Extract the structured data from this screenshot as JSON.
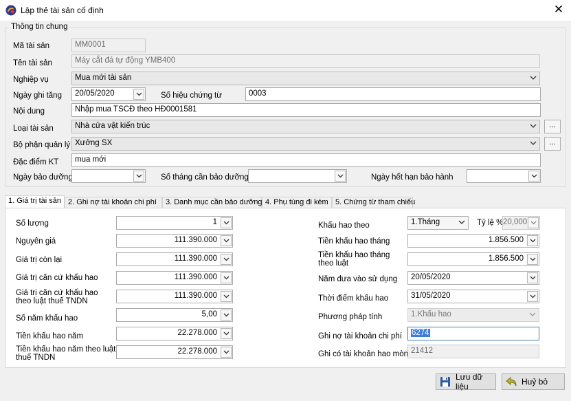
{
  "window": {
    "title": "Lập thẻ tài sản cố định"
  },
  "general": {
    "group_title": "Thông tin chung",
    "asset_code_label": "Mã tài sản",
    "asset_code": "MM0001",
    "asset_name_label": "Tên tài sản",
    "asset_name": "Máy cắt đá tự động YMB400",
    "operation_label": "Nghiệp vụ",
    "operation": "Mua mới tài sản",
    "date_label": "Ngày ghi tăng",
    "date": "20/05/2020",
    "voucher_label": "Số hiệu chứng từ",
    "voucher": "0003",
    "content_label": "Nội dung",
    "content": "Nhập mua TSCĐ theo HĐ0001581",
    "type_label": "Loại tài sản",
    "type": "Nhà cửa vật kiến trúc",
    "dept_label": "Bộ phận quản lý",
    "dept": "Xưởng SX",
    "feature_label": "Đặc điểm KT",
    "feature": "mua mới",
    "maint_date_label": "Ngày bảo dưỡng",
    "maint_date": "",
    "maint_months_label": "Số tháng cần bảo dưỡng",
    "maint_months": "",
    "warranty_label": "Ngày hết hạn bảo hành",
    "warranty": "",
    "ellipsis": "..."
  },
  "tabs": [
    {
      "label": "1. Giá trị tài sản"
    },
    {
      "label": "2. Ghi nợ tài khoản chi phí"
    },
    {
      "label": "3. Danh mục cần bảo dưỡng"
    },
    {
      "label": "4. Phụ tùng đi kèm"
    },
    {
      "label": "5. Chứng từ tham chiếu"
    }
  ],
  "value": {
    "qty_label": "Số lượng",
    "qty": "1",
    "orig_label": "Nguyên giá",
    "orig": "111.390.000",
    "remain_label": "Giá trị còn lại",
    "remain": "111.390.000",
    "base_label": "Giá trị căn cứ khấu hao",
    "base": "111.390.000",
    "base_tax_label_1": "Giá trị căn cứ khấu hao",
    "base_tax_label_2": "theo luật thuế TNDN",
    "base_tax": "111.390.000",
    "years_label": "Số năm khấu hao",
    "years": "5,00",
    "annual_label": "Tiền khấu hao năm",
    "annual": "22.278.000",
    "annual_tax_label_1": "Tiền khấu hao năm theo luật",
    "annual_tax_label_2": "thuế TNDN",
    "annual_tax": "22.278.000",
    "dep_by_label": "Khấu hao theo",
    "dep_by": "1.Tháng",
    "rate_label": "Tỷ lệ %",
    "rate": "20,000",
    "monthly_label": "Tiền khấu hao tháng",
    "monthly": "1.856.500",
    "monthly_law_label_1": "Tiền khấu hao tháng",
    "monthly_law_label_2": "theo luật",
    "monthly_law": "1.856.500",
    "use_year_label": "Năm đưa vào sử dụng",
    "use_year": "20/05/2020",
    "dep_time_label": "Thời điểm khấu hao",
    "dep_time": "31/05/2020",
    "method_label": "Phương pháp tính",
    "method": "1.Khấu hao",
    "debit_label": "Ghi nợ tài khoản chi phí",
    "debit": "6274",
    "credit_label": "Ghi có tài khoản hao mòn",
    "credit": "21412"
  },
  "buttons": {
    "save": "Lưu dữ liệu",
    "cancel": "Huỷ bỏ"
  }
}
